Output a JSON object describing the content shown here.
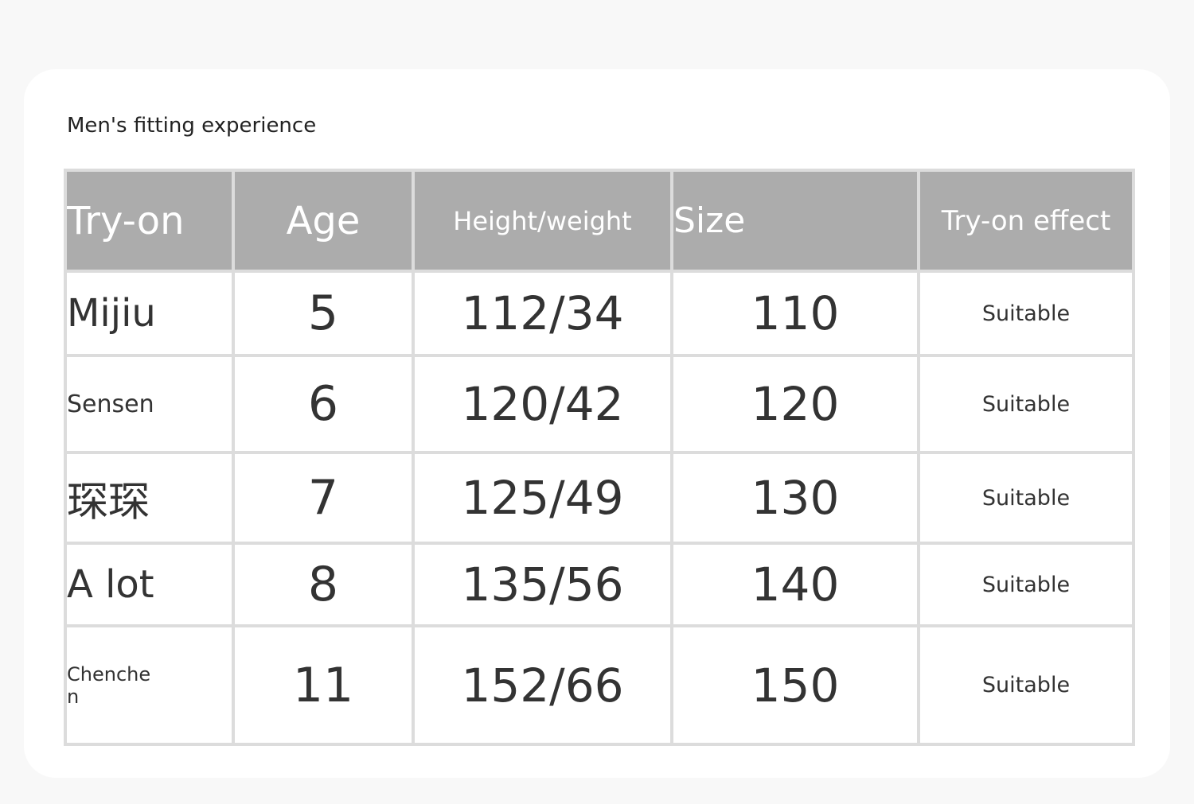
{
  "title": "Men's fitting experience",
  "table": {
    "headers": {
      "tryon": "Try-on",
      "age": "Age",
      "height_weight": "Height/weight",
      "size": "Size",
      "effect": "Try-on effect"
    },
    "rows": [
      {
        "name": "Mijiu",
        "age": "5",
        "height_weight": "112/34",
        "size": "110",
        "effect": "Suitable"
      },
      {
        "name": "Sensen",
        "age": "6",
        "height_weight": "120/42",
        "size": "120",
        "effect": "Suitable"
      },
      {
        "name": "琛琛",
        "age": "7",
        "height_weight": "125/49",
        "size": "130",
        "effect": "Suitable"
      },
      {
        "name": "A lot",
        "age": "8",
        "height_weight": "135/56",
        "size": "140",
        "effect": "Suitable"
      },
      {
        "name": "Chenchen",
        "age": "11",
        "height_weight": "152/66",
        "size": "150",
        "effect": "Suitable"
      }
    ]
  },
  "colors": {
    "header_bg": "#acacac",
    "grid_line": "#dcdcdc",
    "page_bg": "#f8f8f8",
    "card_bg": "#ffffff"
  }
}
